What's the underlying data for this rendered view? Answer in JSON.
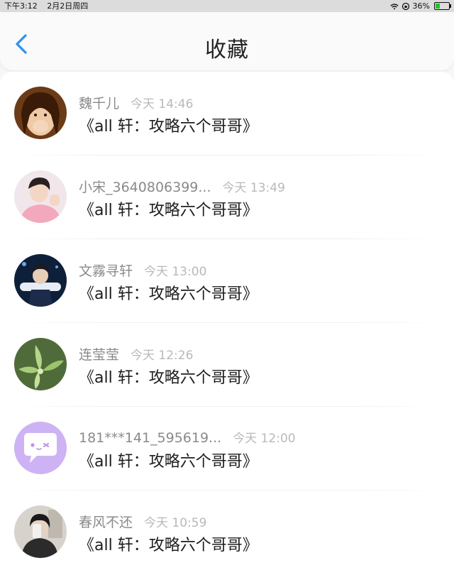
{
  "status_bar": {
    "time": "下午3:12",
    "date": "2月2日周四",
    "battery": "36%",
    "battery_level": 0.36
  },
  "header": {
    "title": "收藏",
    "back_icon": "chevron-left-icon",
    "accent": "#2f8ff0"
  },
  "items": [
    {
      "name": "魏千儿",
      "time": "今天 14:46",
      "post": "《all 轩：攻略六个哥哥》",
      "avatar": "avatar-girl-photo"
    },
    {
      "name": "小宋_3640806399...",
      "time": "今天 13:49",
      "post": "《all 轩：攻略六个哥哥》",
      "avatar": "avatar-boy-pink-photo"
    },
    {
      "name": "文霧寻轩",
      "time": "今天 13:00",
      "post": "《all 轩：攻略六个哥哥》",
      "avatar": "avatar-boy-stage-photo"
    },
    {
      "name": "连莹莹",
      "time": "今天 12:26",
      "post": "《all 轩：攻略六个哥哥》",
      "avatar": "avatar-orchid-photo"
    },
    {
      "name": "181***141_595619...",
      "time": "今天 12:00",
      "post": "《all 轩：攻略六个哥哥》",
      "avatar": "default-chat-avatar-icon"
    },
    {
      "name": "春风不还",
      "time": "今天 10:59",
      "post": "《all 轩：攻略六个哥哥》",
      "avatar": "avatar-mirror-selfie-photo"
    }
  ]
}
